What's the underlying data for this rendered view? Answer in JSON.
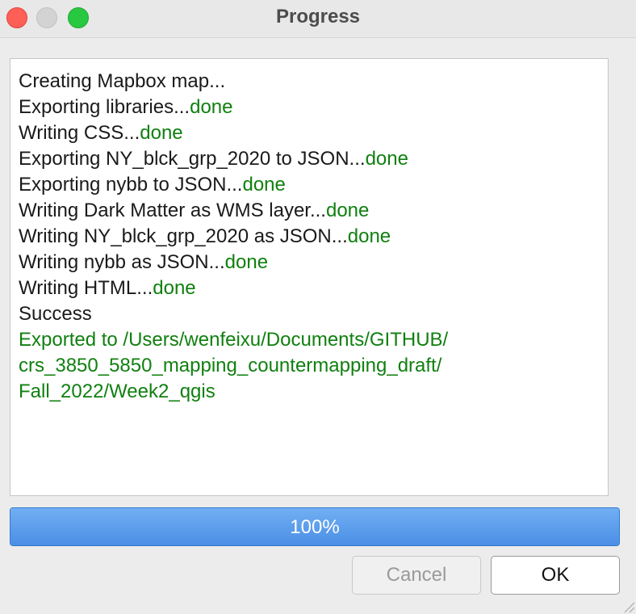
{
  "window": {
    "title": "Progress"
  },
  "log": {
    "lines": [
      {
        "text": "Creating Mapbox map...",
        "status": ""
      },
      {
        "text": "Exporting libraries...",
        "status": "done"
      },
      {
        "text": "Writing CSS...",
        "status": "done"
      },
      {
        "text": "Exporting NY_blck_grp_2020 to JSON...",
        "status": "done"
      },
      {
        "text": "Exporting nybb to JSON...",
        "status": "done"
      },
      {
        "text": "Writing Dark Matter as WMS layer...",
        "status": "done"
      },
      {
        "text": "Writing NY_blck_grp_2020 as JSON...",
        "status": "done"
      },
      {
        "text": "Writing nybb as JSON...",
        "status": "done"
      },
      {
        "text": "Writing HTML...",
        "status": "done"
      },
      {
        "text": "Success",
        "status": ""
      }
    ],
    "result_lines": [
      "Exported to /Users/wenfeixu/Documents/GITHUB/",
      "crs_3850_5850_mapping_countermapping_draft/",
      "Fall_2022/Week2_qgis"
    ]
  },
  "progress": {
    "value": 1.0,
    "label": "100%"
  },
  "buttons": {
    "cancel": "Cancel",
    "ok": "OK"
  },
  "colors": {
    "done": "#108010",
    "progress_fill": "#4a8fe5"
  }
}
